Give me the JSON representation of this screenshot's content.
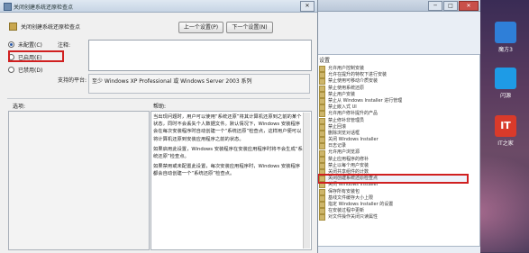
{
  "window_title": "关闭创建系统还原检查点",
  "setting_name": "关闭创建系统还原检查点",
  "buttons": {
    "prev": "上一个设置(P)",
    "next": "下一个设置(N)"
  },
  "radios": [
    {
      "label": "未配置(C)",
      "selected": true
    },
    {
      "label": "已启用(E)",
      "selected": false
    },
    {
      "label": "已禁用(D)",
      "selected": false
    }
  ],
  "labels": {
    "comment": "注释:",
    "supported_on": "支持的平台:",
    "options": "选项:",
    "help": "帮助:"
  },
  "supported_on_value": "至少 Windows XP Professional 或 Windows Server 2003 系列",
  "help_paragraphs": [
    "当出现问题时，用户可以使用“系统还原”将其计算机还原到之前的某个状态，同时不会丢失个人数据文件。默认情况下，Windows 安装程序会在每次安装程序时自动创建一个“系统还原”检查点，这样用户便可以将计算机还原到安装应用程序之前的状态。",
    "如果启用此设置，Windows 安装程序在安装应用程序时将不会生成“系统还原”检查点。",
    "如果禁用或未配置此设置，每次安装应用程序时，Windows 安装程序都会自动创建一个“系统还原”检查点。"
  ],
  "background_window": {
    "tree_header": "设置",
    "items": [
      "允许用户控制安装",
      "允许在提升的特权下进行安装",
      "禁止使用可移动介质安装",
      "禁止使用系统还原",
      "禁止用户安装",
      "禁止从 Windows Installer 进行管理",
      "禁止嵌入式 UI",
      "允许用户修补提升的产品",
      "禁止修补非管理员",
      "禁止回滚",
      "删除浏览对话框",
      "关闭 Windows Installer",
      "日志记录",
      "允许用户浏览源",
      "禁止应用程序的修补",
      "禁止以每个用户安装",
      "关闭共享组件的计数",
      "关闭创建系统还原检查点",
      "关闭 Windows Installer",
      "保存所有安装包",
      "基线文件缓存大小上限",
      "指定 Windows Installer 的设置",
      "在安装过程中更新",
      "对文件操作关闭只读属性"
    ],
    "selected_index": 17,
    "btn_min": "─",
    "btn_max": "□",
    "btn_close": "✕"
  },
  "desktop_icons": [
    {
      "label": "魔方3",
      "color": "#2f7fd8"
    },
    {
      "label": "闪源",
      "color": "#1e9be6"
    },
    {
      "label": "IT之家",
      "color": "#d93a2a"
    }
  ],
  "desktop_icon_glyphs": [
    "",
    "",
    "IT"
  ],
  "title_close_glyph": "✕"
}
